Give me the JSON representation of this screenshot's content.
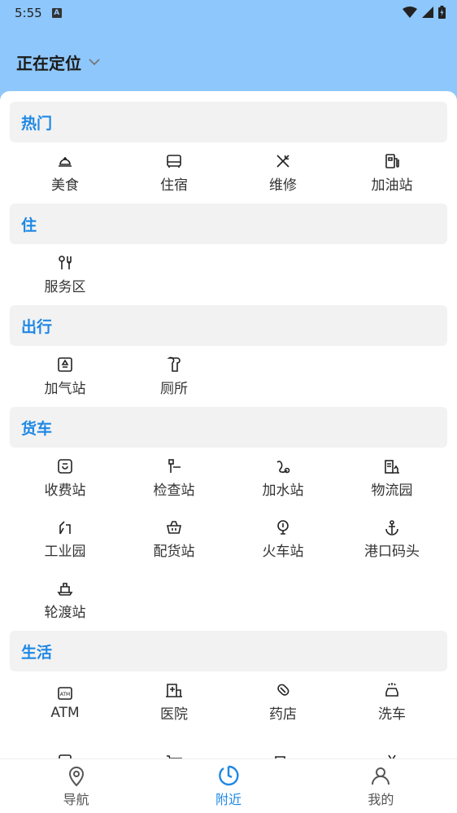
{
  "status": {
    "time": "5:55",
    "notif": "A"
  },
  "header": {
    "title": "正在定位"
  },
  "sections": [
    {
      "title": "热门",
      "items": [
        {
          "label": "美食",
          "icon": "cloche-icon"
        },
        {
          "label": "住宿",
          "icon": "bed-icon"
        },
        {
          "label": "维修",
          "icon": "tools-icon"
        },
        {
          "label": "加油站",
          "icon": "fuel-icon"
        }
      ]
    },
    {
      "title": "住",
      "items": [
        {
          "label": "服务区",
          "icon": "utensils-icon"
        }
      ]
    },
    {
      "title": "出行",
      "items": [
        {
          "label": "加气站",
          "icon": "gas-station-icon"
        },
        {
          "label": "厕所",
          "icon": "toilet-paper-icon"
        }
      ]
    },
    {
      "title": "货车",
      "items": [
        {
          "label": "收费站",
          "icon": "toll-icon"
        },
        {
          "label": "检查站",
          "icon": "checkpoint-icon"
        },
        {
          "label": "加水站",
          "icon": "water-icon"
        },
        {
          "label": "物流园",
          "icon": "logistics-icon"
        },
        {
          "label": "工业园",
          "icon": "industry-icon"
        },
        {
          "label": "配货站",
          "icon": "basket-icon"
        },
        {
          "label": "火车站",
          "icon": "train-icon"
        },
        {
          "label": "港口码头",
          "icon": "anchor-icon"
        },
        {
          "label": "轮渡站",
          "icon": "ferry-icon"
        }
      ]
    },
    {
      "title": "生活",
      "items": [
        {
          "label": "ATM",
          "icon": "atm-icon"
        },
        {
          "label": "医院",
          "icon": "hospital-icon"
        },
        {
          "label": "药店",
          "icon": "pill-icon"
        },
        {
          "label": "洗车",
          "icon": "car-wash-icon"
        },
        {
          "label": "",
          "icon": "washer-icon"
        },
        {
          "label": "",
          "icon": "cart-icon"
        },
        {
          "label": "",
          "icon": "truck-icon"
        },
        {
          "label": "",
          "icon": "scissors-icon"
        }
      ]
    }
  ],
  "nav": [
    {
      "label": "导航",
      "icon": "location-pin-icon",
      "active": false
    },
    {
      "label": "附近",
      "icon": "nearby-icon",
      "active": true
    },
    {
      "label": "我的",
      "icon": "user-icon",
      "active": false
    }
  ],
  "colors": {
    "accent": "#1e88e5",
    "header_bg": "#8ec7fb",
    "section_bg": "#f2f2f2"
  }
}
